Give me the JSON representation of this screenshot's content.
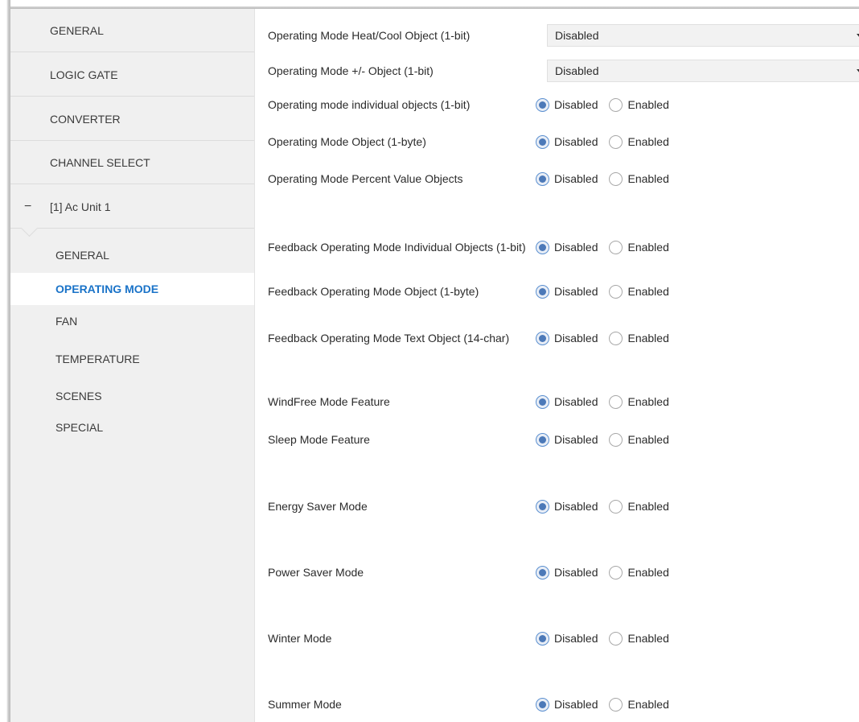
{
  "sidebar": {
    "top_items": [
      {
        "label": "GENERAL"
      },
      {
        "label": "LOGIC GATE"
      },
      {
        "label": "CONVERTER"
      },
      {
        "label": "CHANNEL SELECT"
      }
    ],
    "group": {
      "toggle": "−",
      "label": "[1] Ac Unit 1"
    },
    "sub_items": [
      {
        "label": "GENERAL",
        "active": false
      },
      {
        "label": "OPERATING MODE",
        "active": true
      },
      {
        "label": "FAN",
        "active": false
      },
      {
        "label": "TEMPERATURE",
        "active": false
      },
      {
        "label": "SCENES",
        "active": false
      },
      {
        "label": "SPECIAL",
        "active": false
      }
    ]
  },
  "main": {
    "dropdowns": [
      {
        "label": "Operating Mode Heat/Cool Object (1-bit)",
        "value": "Disabled"
      },
      {
        "label": "Operating Mode +/- Object (1-bit)",
        "value": "Disabled"
      }
    ],
    "radio_options": {
      "off": "Disabled",
      "on": "Enabled"
    },
    "radio_rows": [
      {
        "label": "Operating mode individual objects (1-bit)",
        "selected": "Disabled"
      },
      {
        "label": "Operating Mode Object (1-byte)",
        "selected": "Disabled"
      },
      {
        "label": "Operating Mode Percent Value Objects",
        "selected": "Disabled"
      },
      {
        "label": "Feedback Operating Mode Individual Objects (1-bit)",
        "selected": "Disabled"
      },
      {
        "label": "Feedback Operating Mode Object (1-byte)",
        "selected": "Disabled"
      },
      {
        "label": "Feedback Operating Mode Text Object (14-char)",
        "selected": "Disabled"
      },
      {
        "label": "WindFree Mode Feature",
        "selected": "Disabled"
      },
      {
        "label": "Sleep Mode Feature",
        "selected": "Disabled"
      },
      {
        "label": "Energy Saver Mode",
        "selected": "Disabled"
      },
      {
        "label": "Power Saver Mode",
        "selected": "Disabled"
      },
      {
        "label": "Winter Mode",
        "selected": "Disabled"
      },
      {
        "label": "Summer Mode",
        "selected": "Disabled"
      }
    ]
  },
  "colors": {
    "accent": "#1a73c8",
    "radio_selected": "#4c79b8",
    "sidebar_bg": "#f0f0f0"
  }
}
